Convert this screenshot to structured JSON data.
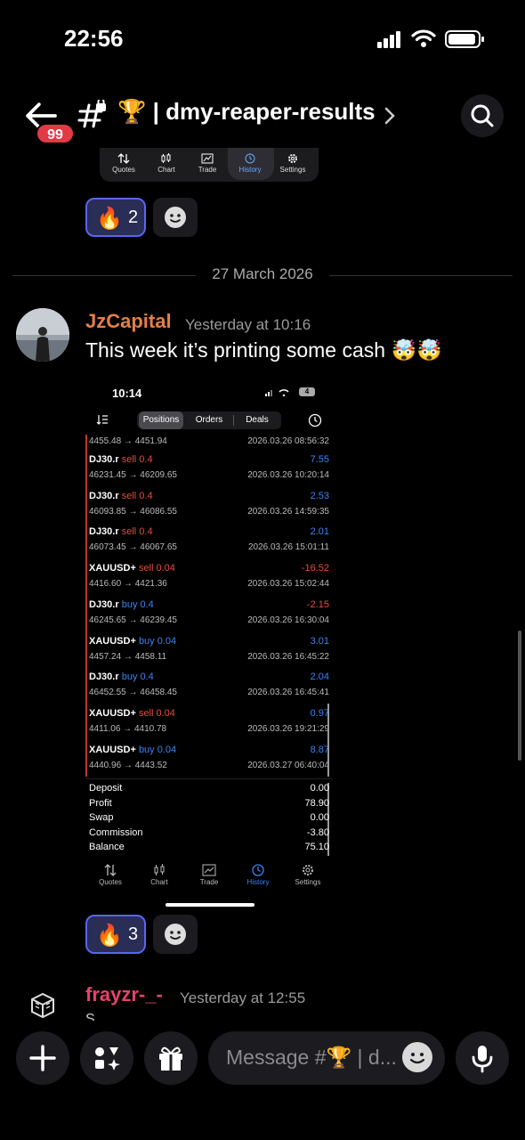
{
  "status_bar": {
    "time": "22:56"
  },
  "header": {
    "unread_count": "99",
    "channel_emoji": "🏆",
    "channel_name": "| dmy-reaper-results"
  },
  "prev_screenshot_tabs": [
    "Quotes",
    "Chart",
    "Trade",
    "History",
    "Settings"
  ],
  "prev_reactions": {
    "fire_emoji": "🔥",
    "fire_count": "2"
  },
  "date_divider": "27 March 2026",
  "message": {
    "username": "JzCapital",
    "timestamp": "Yesterday at 10:16",
    "text": "This week it’s printing some cash 🤯🤯",
    "attachment": {
      "status_time": "10:14",
      "battery": "4",
      "segments": [
        "Positions",
        "Orders",
        "Deals"
      ],
      "first_row": {
        "price": "4455.48 → 4451.94",
        "date": "2026.03.26 08:56:32"
      },
      "trades": [
        {
          "symbol": "DJ30.r",
          "side": "sell",
          "lot": "sell 0.4",
          "prices": "46231.45 → 46209.65",
          "pl": "7.55",
          "date": "2026.03.26 10:20:14"
        },
        {
          "symbol": "DJ30.r",
          "side": "sell",
          "lot": "sell 0.4",
          "prices": "46093.85 → 46086.55",
          "pl": "2.53",
          "date": "2026.03.26 14:59:35"
        },
        {
          "symbol": "DJ30.r",
          "side": "sell",
          "lot": "sell 0.4",
          "prices": "46073.45 → 46067.65",
          "pl": "2.01",
          "date": "2026.03.26 15:01:11"
        },
        {
          "symbol": "XAUUSD+",
          "side": "sell",
          "lot": "sell 0.04",
          "prices": "4416.60 → 4421.36",
          "pl": "-16.52",
          "date": "2026.03.26 15:02:44"
        },
        {
          "symbol": "DJ30.r",
          "side": "buy",
          "lot": "buy 0.4",
          "prices": "46245.65 → 46239.45",
          "pl": "-2.15",
          "date": "2026.03.26 16:30:04"
        },
        {
          "symbol": "XAUUSD+",
          "side": "buy",
          "lot": "buy 0.04",
          "prices": "4457.24 → 4458.11",
          "pl": "3.01",
          "date": "2026.03.26 16:45:22"
        },
        {
          "symbol": "DJ30.r",
          "side": "buy",
          "lot": "buy 0.4",
          "prices": "46452.55 → 46458.45",
          "pl": "2.04",
          "date": "2026.03.26 16:45:41"
        },
        {
          "symbol": "XAUUSD+",
          "side": "sell",
          "lot": "sell 0.04",
          "prices": "4411.06 → 4410.78",
          "pl": "0.97",
          "date": "2026.03.26 19:21:29"
        },
        {
          "symbol": "XAUUSD+",
          "side": "buy",
          "lot": "buy 0.04",
          "prices": "4440.96 → 4443.52",
          "pl": "8.87",
          "date": "2026.03.27 06:40:04"
        }
      ],
      "summary": [
        {
          "label": "Deposit",
          "value": "0.00"
        },
        {
          "label": "Profit",
          "value": "78.90"
        },
        {
          "label": "Swap",
          "value": "0.00"
        },
        {
          "label": "Commission",
          "value": "-3.80"
        },
        {
          "label": "Balance",
          "value": "75.10"
        }
      ],
      "tabs": [
        "Quotes",
        "Chart",
        "Trade",
        "History",
        "Settings"
      ],
      "selected_tab": "History"
    },
    "reactions": {
      "fire_emoji": "🔥",
      "fire_count": "3"
    }
  },
  "next_message": {
    "username": "frayzr-_-",
    "timestamp": "Yesterday at 12:55",
    "clipped_text": "S"
  },
  "composer": {
    "placeholder": "Message #🏆 | d..."
  },
  "colors": {
    "accent": "#5865f2",
    "username_1": "#e67e45",
    "username_2": "#e8416a",
    "badge": "#e23a45",
    "profit_blue": "#3b82f6",
    "loss_red": "#e74c3c"
  }
}
